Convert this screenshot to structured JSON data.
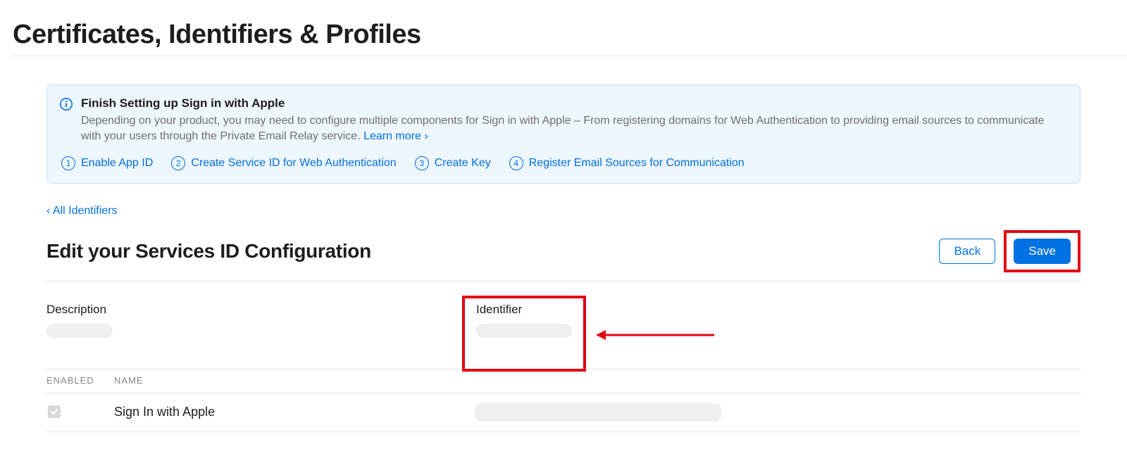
{
  "page": {
    "title": "Certificates, Identifiers & Profiles"
  },
  "info": {
    "title": "Finish Setting up Sign in with Apple",
    "desc_part1": "Depending on your product, you may need to configure multiple components for Sign in with Apple – From registering domains for Web Authentication to providing email sources to communicate with your users through the Private Email Relay service. ",
    "learn_more": "Learn more ›",
    "steps": [
      {
        "num": "1",
        "label": "Enable App ID"
      },
      {
        "num": "2",
        "label": "Create Service ID for Web Authentication"
      },
      {
        "num": "3",
        "label": "Create Key"
      },
      {
        "num": "4",
        "label": "Register Email Sources for Communication"
      }
    ]
  },
  "nav": {
    "back_all": "‹ All Identifiers"
  },
  "section": {
    "title": "Edit your Services ID Configuration",
    "back_btn": "Back",
    "save_btn": "Save"
  },
  "fields": {
    "description_label": "Description",
    "identifier_label": "Identifier"
  },
  "table": {
    "headers": {
      "enabled": "ENABLED",
      "name": "NAME"
    },
    "rows": [
      {
        "checked": true,
        "name": "Sign In with Apple"
      }
    ]
  },
  "annotation": {
    "highlight_color": "#e30613"
  }
}
